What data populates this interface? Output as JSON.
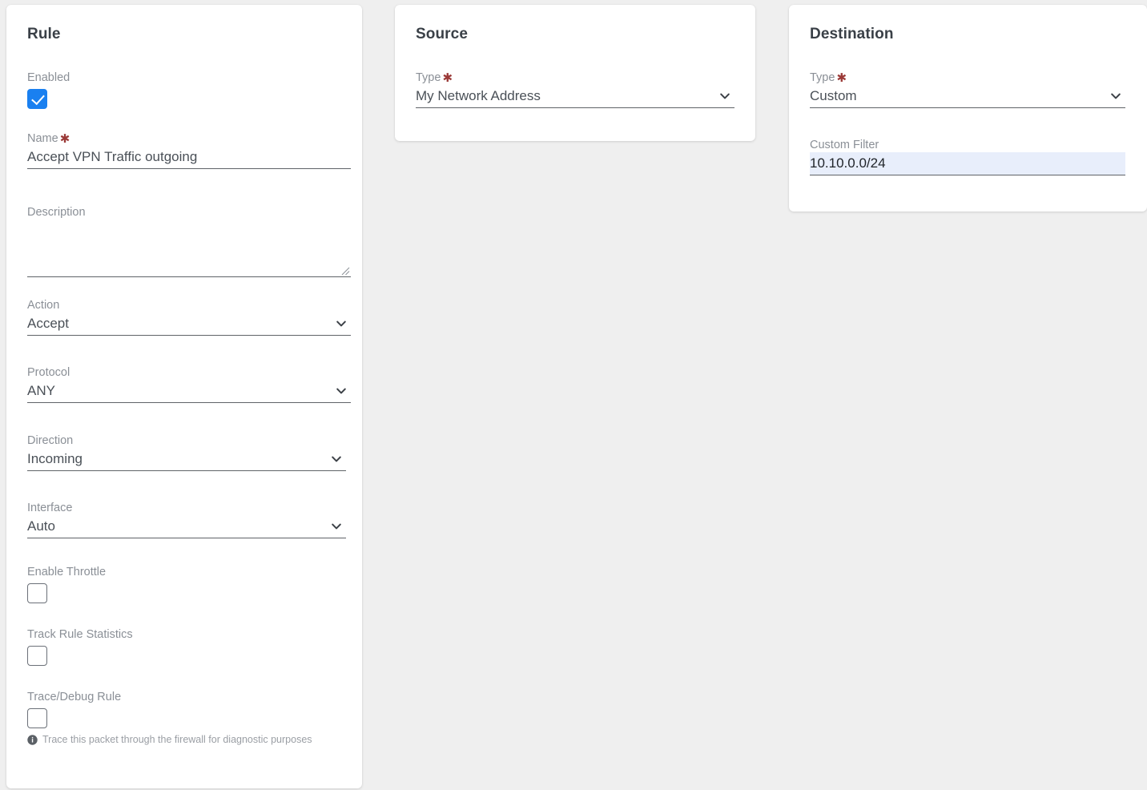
{
  "page": {
    "background_color": "#efefef",
    "accent_color": "#1a80f0",
    "required_marker_color": "#9b3a38",
    "autofill_background": "#e8eefb"
  },
  "rule_card": {
    "title": "Rule",
    "enabled": {
      "label": "Enabled",
      "checked": true
    },
    "name": {
      "label": "Name",
      "required": true,
      "value": "Accept VPN Traffic outgoing"
    },
    "description": {
      "label": "Description",
      "value": "",
      "placeholder": ""
    },
    "action": {
      "label": "Action",
      "value": "Accept"
    },
    "protocol": {
      "label": "Protocol",
      "value": "ANY"
    },
    "direction": {
      "label": "Direction",
      "value": "Incoming"
    },
    "interface": {
      "label": "Interface",
      "value": "Auto"
    },
    "enable_throttle": {
      "label": "Enable Throttle",
      "checked": false
    },
    "track_rule_statistics": {
      "label": "Track Rule Statistics",
      "checked": false
    },
    "trace_debug_rule": {
      "label": "Trace/Debug Rule",
      "checked": false,
      "help": "Trace this packet through the firewall for diagnostic purposes"
    }
  },
  "source_card": {
    "title": "Source",
    "type": {
      "label": "Type",
      "required": true,
      "value": "My Network Address"
    }
  },
  "destination_card": {
    "title": "Destination",
    "type": {
      "label": "Type",
      "required": true,
      "value": "Custom"
    },
    "custom_filter": {
      "label": "Custom Filter",
      "value": "10.10.0.0/24"
    }
  },
  "icons": {
    "chevron_down": "chevron-down-icon",
    "info": "info-icon",
    "resize": "resize-handle-icon",
    "check": "check-icon"
  }
}
